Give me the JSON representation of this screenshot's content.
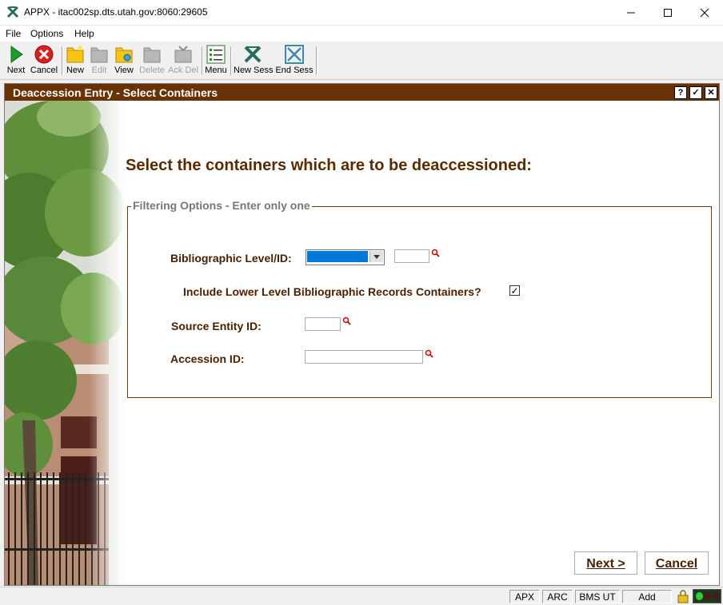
{
  "window": {
    "title": "APPX - itac002sp.dts.utah.gov:8060:29605"
  },
  "menu": [
    "File",
    "Options",
    "Help"
  ],
  "toolbar": {
    "next": "Next",
    "cancel": "Cancel",
    "new": "New",
    "edit": "Edit",
    "view": "View",
    "delete": "Delete",
    "ack_del": "Ack Del",
    "menu": "Menu",
    "new_sess": "New Sess",
    "end_sess": "End Sess"
  },
  "frame": {
    "title": "Deaccession Entry - Select Containers",
    "help_glyph": "?",
    "ok_glyph": "✓",
    "close_glyph": "✕"
  },
  "form": {
    "heading": "Select the containers which are to be deaccessioned:",
    "legend": "Filtering Options - Enter only one",
    "biblio_label": "Bibliographic Level/ID:",
    "include_label": "Include Lower Level Bibliographic Records Containers?",
    "include_checked": true,
    "include_mark": "✓",
    "source_label": "Source Entity ID:",
    "accession_label": "Accession ID:",
    "biblio_id_value": "",
    "source_value": "",
    "accession_value": ""
  },
  "buttons": {
    "next": "Next >",
    "cancel": "Cancel"
  },
  "status": {
    "apx": "APX",
    "arc": "ARC",
    "bms": "BMS UT",
    "mode": "Add"
  },
  "colors": {
    "header": "#6a3202",
    "label": "#4a2000",
    "heading": "#5a2b00",
    "selection": "#0078d7"
  }
}
